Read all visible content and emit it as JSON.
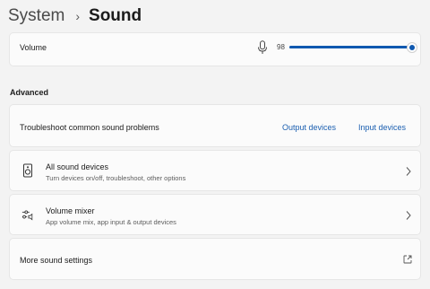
{
  "breadcrumb": {
    "parent": "System",
    "separator": "›",
    "current": "Sound"
  },
  "volume": {
    "label": "Volume",
    "value": "98",
    "level_percent": 98,
    "icon": "microphone-icon"
  },
  "advanced": {
    "title": "Advanced",
    "troubleshoot": {
      "label": "Troubleshoot common sound problems",
      "output_link": "Output devices",
      "input_link": "Input devices"
    },
    "all_devices": {
      "title": "All sound devices",
      "description": "Turn devices on/off, troubleshoot, other options",
      "icon": "speaker-device-icon"
    },
    "volume_mixer": {
      "title": "Volume mixer",
      "description": "App volume mix, app input & output devices",
      "icon": "mixer-icon"
    },
    "more_settings": {
      "label": "More sound settings",
      "icon": "open-external-icon"
    }
  },
  "colors": {
    "accent": "#1059b0",
    "link": "#1b5fb0",
    "background": "#f3f3f3",
    "card": "#fbfbfb"
  }
}
